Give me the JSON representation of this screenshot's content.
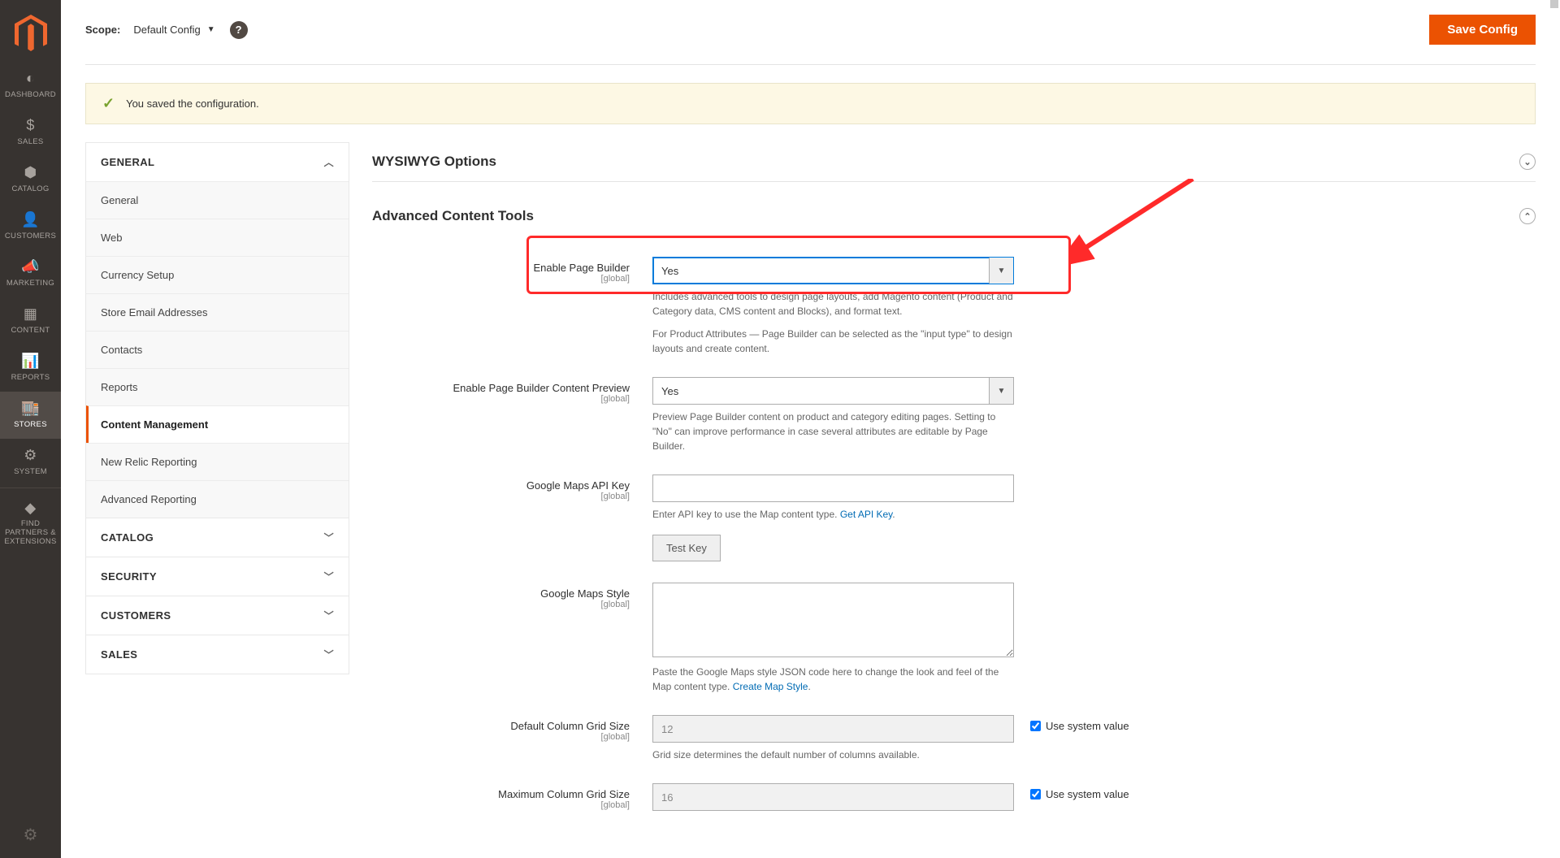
{
  "header": {
    "scope_label": "Scope:",
    "scope_value": "Default Config",
    "save_button": "Save Config"
  },
  "message": {
    "success": "You saved the configuration."
  },
  "nav": {
    "items": [
      {
        "label": "DASHBOARD"
      },
      {
        "label": "SALES"
      },
      {
        "label": "CATALOG"
      },
      {
        "label": "CUSTOMERS"
      },
      {
        "label": "MARKETING"
      },
      {
        "label": "CONTENT"
      },
      {
        "label": "REPORTS"
      },
      {
        "label": "STORES"
      },
      {
        "label": "SYSTEM"
      },
      {
        "label": "FIND PARTNERS & EXTENSIONS"
      }
    ]
  },
  "sidebar": {
    "groups": [
      {
        "title": "GENERAL",
        "expanded": true,
        "items": [
          {
            "label": "General"
          },
          {
            "label": "Web"
          },
          {
            "label": "Currency Setup"
          },
          {
            "label": "Store Email Addresses"
          },
          {
            "label": "Contacts"
          },
          {
            "label": "Reports"
          },
          {
            "label": "Content Management",
            "active": true
          },
          {
            "label": "New Relic Reporting"
          },
          {
            "label": "Advanced Reporting"
          }
        ]
      },
      {
        "title": "CATALOG",
        "expanded": false
      },
      {
        "title": "SECURITY",
        "expanded": false
      },
      {
        "title": "CUSTOMERS",
        "expanded": false
      },
      {
        "title": "SALES",
        "expanded": false
      }
    ]
  },
  "sections": {
    "wysiwyg": {
      "title": "WYSIWYG Options"
    },
    "advanced": {
      "title": "Advanced Content Tools"
    }
  },
  "scope_tag": "[global]",
  "fields": {
    "enable_pb": {
      "label": "Enable Page Builder",
      "value": "Yes",
      "note1": "Includes advanced tools to design page layouts, add Magento content (Product and Category data, CMS content and Blocks), and format text.",
      "note2": "For Product Attributes — Page Builder can be selected as the \"input type\" to design layouts and create content."
    },
    "enable_preview": {
      "label": "Enable Page Builder Content Preview",
      "value": "Yes",
      "note": "Preview Page Builder content on product and category editing pages. Setting to \"No\" can improve performance in case several attributes are editable by Page Builder."
    },
    "gmaps_key": {
      "label": "Google Maps API Key",
      "note_prefix": "Enter API key to use the Map content type. ",
      "link": "Get API Key",
      "test_btn": "Test Key"
    },
    "gmaps_style": {
      "label": "Google Maps Style",
      "note_prefix": "Paste the Google Maps style JSON code here to change the look and feel of the Map content type. ",
      "link": "Create Map Style"
    },
    "default_grid": {
      "label": "Default Column Grid Size",
      "value": "12",
      "note": "Grid size determines the default number of columns available.",
      "use_system": "Use system value"
    },
    "max_grid": {
      "label": "Maximum Column Grid Size",
      "value": "16",
      "use_system": "Use system value"
    }
  }
}
